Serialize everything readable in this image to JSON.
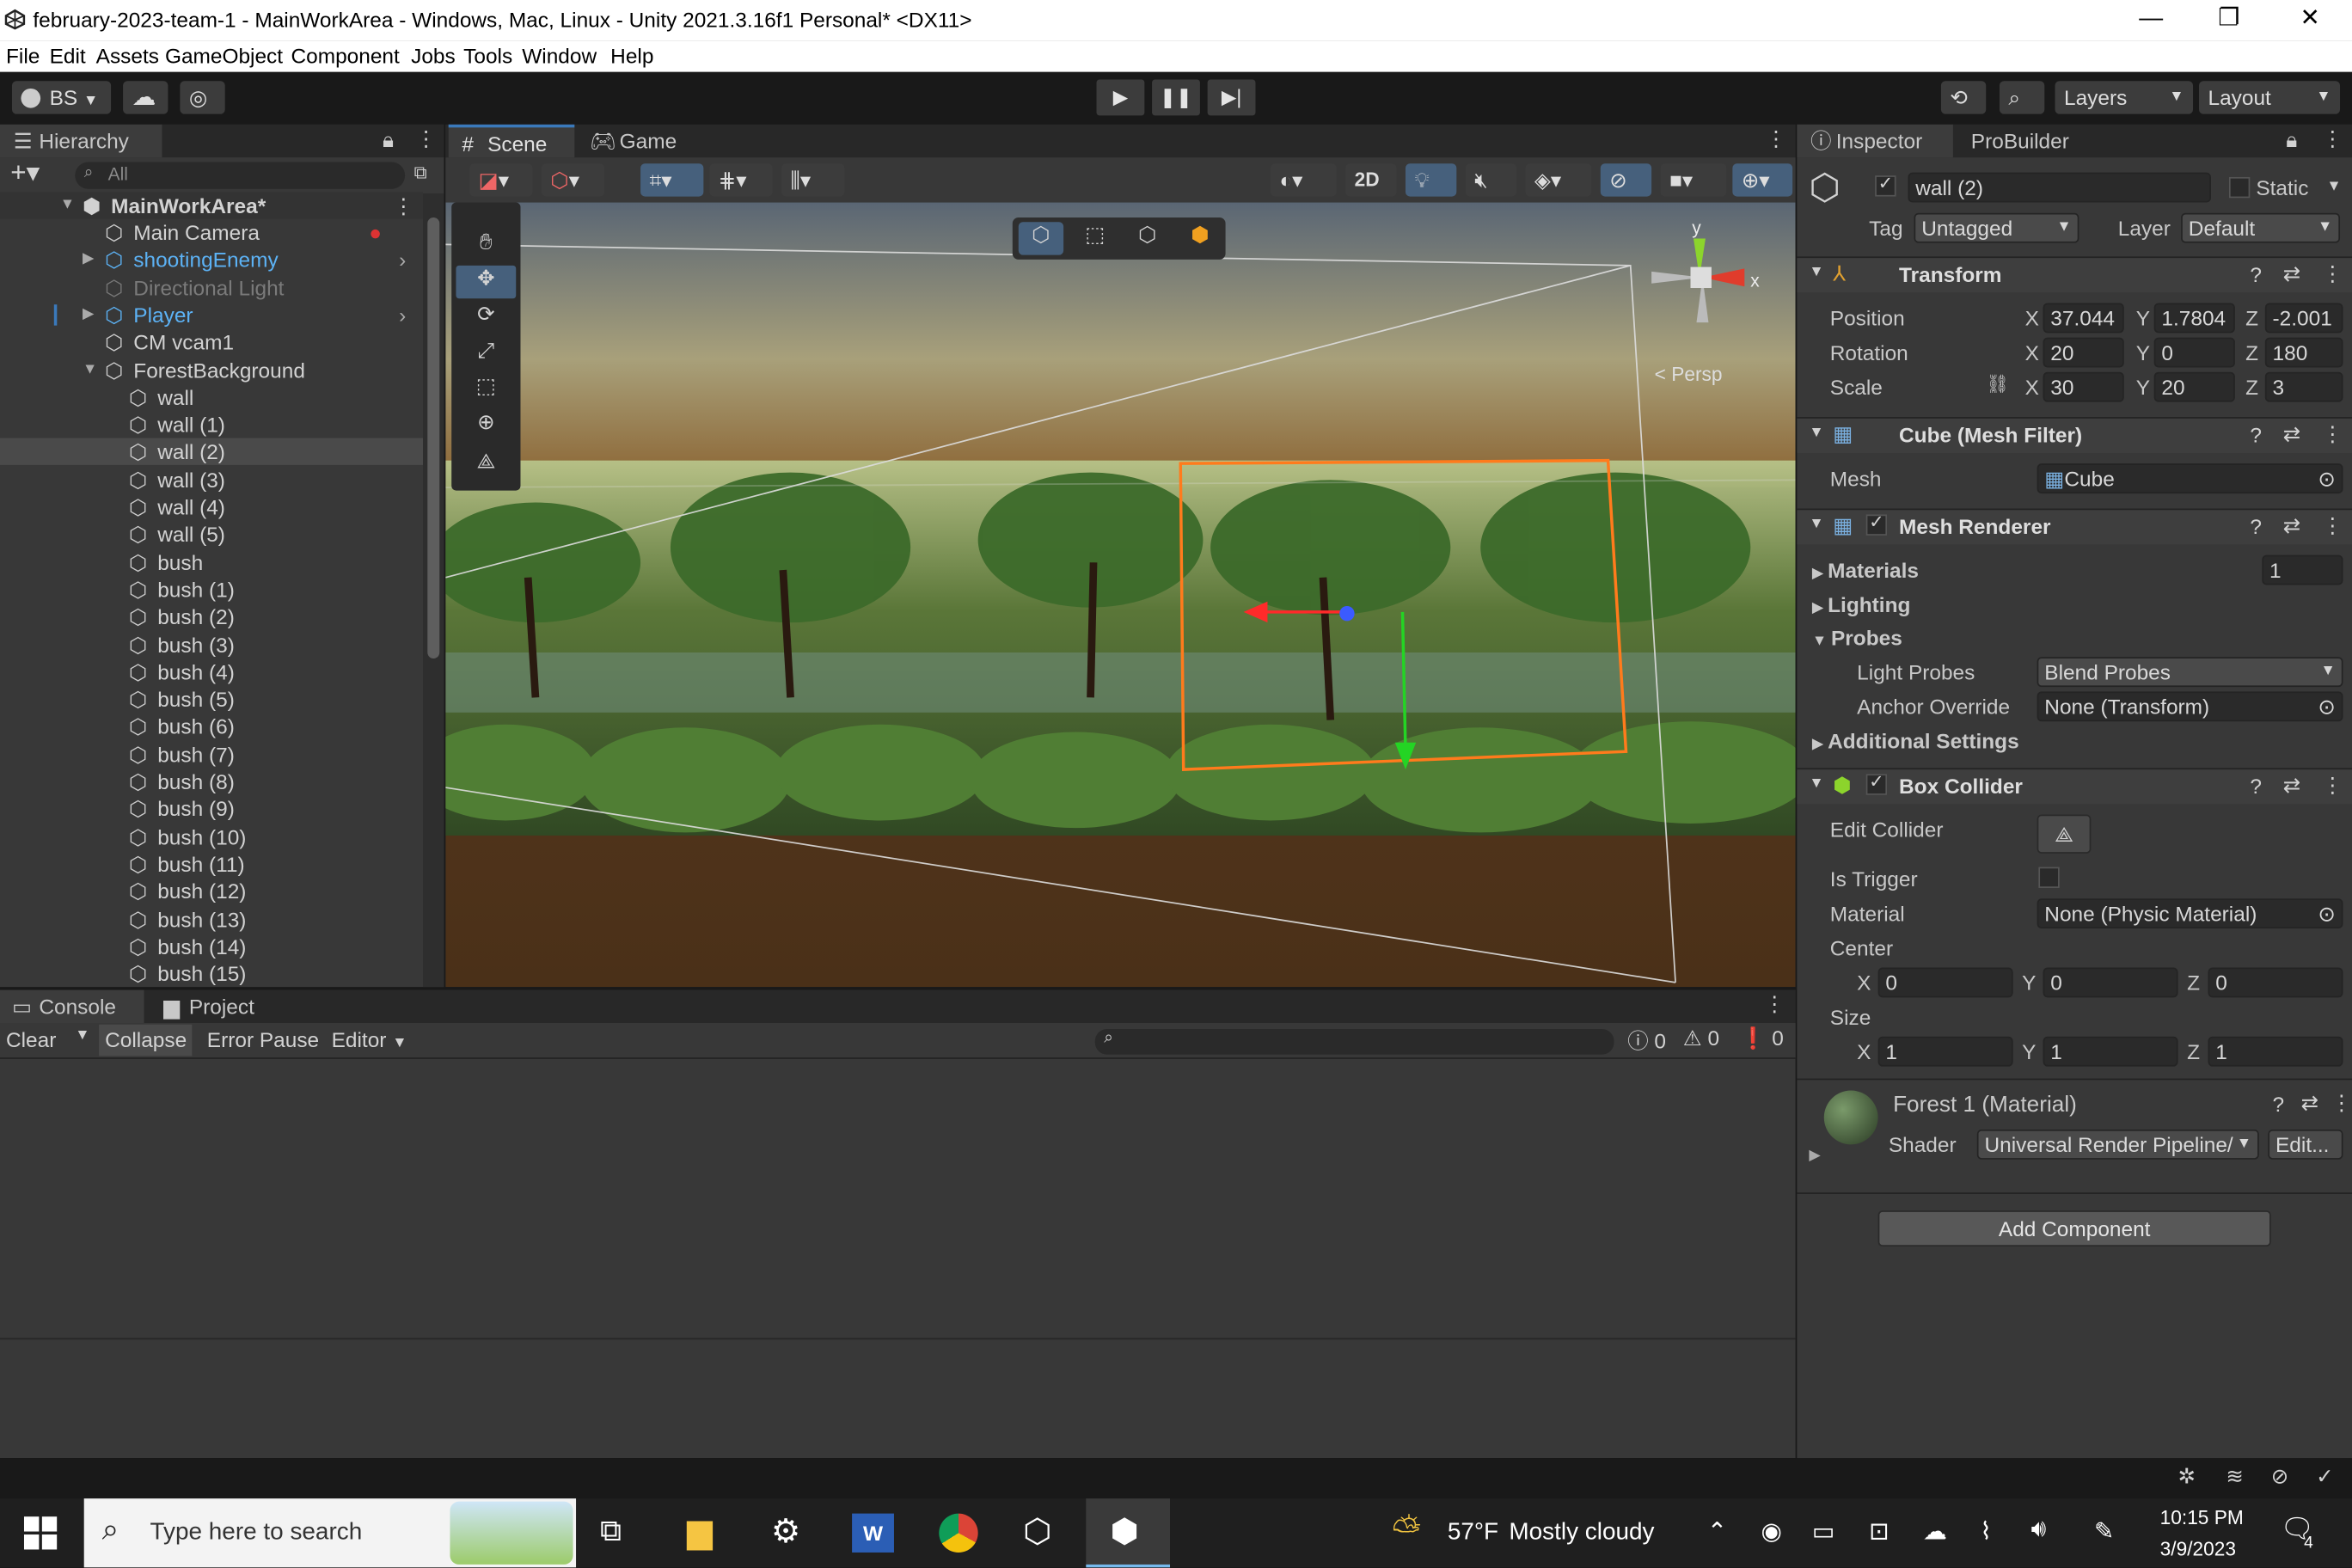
{
  "window": {
    "title": "february-2023-team-1 - MainWorkArea - Windows, Mac, Linux - Unity 2021.3.16f1 Personal* <DX11>",
    "minimize": "—",
    "restore": "❐",
    "close": "✕"
  },
  "menu": [
    "File",
    "Edit",
    "Assets",
    "GameObject",
    "Component",
    "Jobs",
    "Tools",
    "Window",
    "Help"
  ],
  "toolbar": {
    "account": "BS",
    "layers": "Layers",
    "layout": "Layout"
  },
  "hierarchy": {
    "tab": "Hierarchy",
    "search_placeholder": "All",
    "scene_name": "MainWorkArea*",
    "items": [
      {
        "label": "Main Camera",
        "indent": 1
      },
      {
        "label": "shootingEnemy",
        "indent": 1,
        "prefab": true,
        "arrow": true
      },
      {
        "label": "Directional Light",
        "indent": 1,
        "disabled": true
      },
      {
        "label": "Player",
        "indent": 1,
        "prefab": true,
        "arrow": true
      },
      {
        "label": "CM vcam1",
        "indent": 1
      },
      {
        "label": "ForestBackground",
        "indent": 1,
        "expanded": true
      },
      {
        "label": "wall",
        "indent": 2
      },
      {
        "label": "wall (1)",
        "indent": 2
      },
      {
        "label": "wall (2)",
        "indent": 2,
        "selected": true
      },
      {
        "label": "wall (3)",
        "indent": 2
      },
      {
        "label": "wall (4)",
        "indent": 2
      },
      {
        "label": "wall (5)",
        "indent": 2
      },
      {
        "label": "bush",
        "indent": 2
      },
      {
        "label": "bush (1)",
        "indent": 2
      },
      {
        "label": "bush (2)",
        "indent": 2
      },
      {
        "label": "bush (3)",
        "indent": 2
      },
      {
        "label": "bush (4)",
        "indent": 2
      },
      {
        "label": "bush (5)",
        "indent": 2
      },
      {
        "label": "bush (6)",
        "indent": 2
      },
      {
        "label": "bush (7)",
        "indent": 2
      },
      {
        "label": "bush (8)",
        "indent": 2
      },
      {
        "label": "bush (9)",
        "indent": 2
      },
      {
        "label": "bush (10)",
        "indent": 2
      },
      {
        "label": "bush (11)",
        "indent": 2
      },
      {
        "label": "bush (12)",
        "indent": 2
      },
      {
        "label": "bush (13)",
        "indent": 2
      },
      {
        "label": "bush (14)",
        "indent": 2
      },
      {
        "label": "bush (15)",
        "indent": 2
      }
    ]
  },
  "scene": {
    "tab_scene": "Scene",
    "tab_game": "Game",
    "mode_2d": "2D",
    "persp": "Persp",
    "gizmo_y": "y",
    "gizmo_x": "x"
  },
  "console": {
    "tab_console": "Console",
    "tab_project": "Project",
    "clear": "Clear",
    "collapse": "Collapse",
    "error_pause": "Error Pause",
    "editor": "Editor",
    "log_count": "0",
    "warn_count": "0",
    "error_count": "0"
  },
  "inspector": {
    "tab_inspector": "Inspector",
    "tab_probuilder": "ProBuilder",
    "object_name": "wall (2)",
    "static_label": "Static",
    "tag_label": "Tag",
    "tag_value": "Untagged",
    "layer_label": "Layer",
    "layer_value": "Default",
    "transform": {
      "title": "Transform",
      "position_label": "Position",
      "rotation_label": "Rotation",
      "scale_label": "Scale",
      "axis_x": "X",
      "axis_y": "Y",
      "axis_z": "Z",
      "position": {
        "x": "37.044",
        "y": "1.7804",
        "z": "-2.001"
      },
      "rotation": {
        "x": "20",
        "y": "0",
        "z": "180"
      },
      "scale": {
        "x": "30",
        "y": "20",
        "z": "3"
      }
    },
    "mesh_filter": {
      "title": "Cube (Mesh Filter)",
      "mesh_label": "Mesh",
      "mesh_value": "Cube"
    },
    "mesh_renderer": {
      "title": "Mesh Renderer",
      "materials": "Materials",
      "materials_count": "1",
      "lighting": "Lighting",
      "probes": "Probes",
      "light_probes_label": "Light Probes",
      "light_probes_value": "Blend Probes",
      "anchor_override_label": "Anchor Override",
      "anchor_override_value": "None (Transform)",
      "additional_settings": "Additional Settings"
    },
    "box_collider": {
      "title": "Box Collider",
      "edit_collider": "Edit Collider",
      "is_trigger": "Is Trigger",
      "material_label": "Material",
      "material_value": "None (Physic Material)",
      "center_label": "Center",
      "center": {
        "x": "0",
        "y": "0",
        "z": "0"
      },
      "size_label": "Size",
      "size": {
        "x": "1",
        "y": "1",
        "z": "1"
      }
    },
    "material": {
      "title": "Forest 1 (Material)",
      "shader_label": "Shader",
      "shader_value": "Universal Render Pipeline/",
      "edit": "Edit..."
    },
    "add_component": "Add Component"
  },
  "taskbar": {
    "search_placeholder": "Type here to search",
    "weather_temp": "57°F",
    "weather_text": "Mostly cloudy",
    "time": "10:15 PM",
    "date": "3/9/2023",
    "notif_count": "4"
  }
}
